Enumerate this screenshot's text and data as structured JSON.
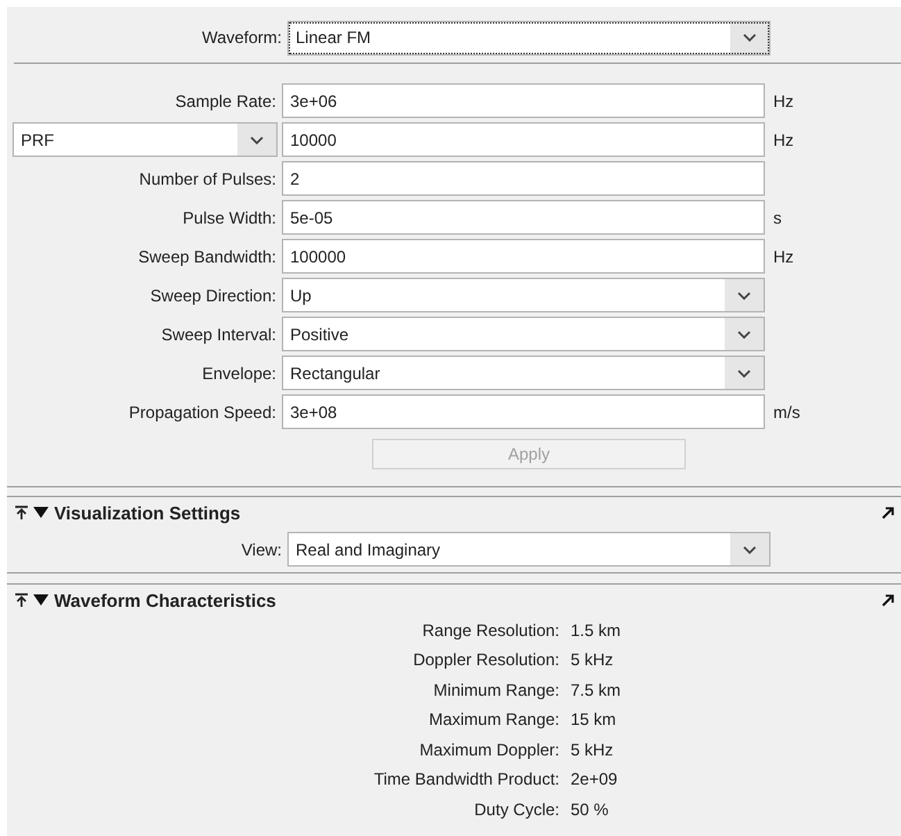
{
  "waveform": {
    "label": "Waveform:",
    "value": "Linear FM",
    "focused": true
  },
  "parameters": [
    {
      "label_selector": false,
      "label": "Sample Rate:",
      "kind": "field",
      "value": "3e+06",
      "unit": "Hz"
    },
    {
      "label_selector": true,
      "label": "PRF",
      "kind": "field",
      "value": "10000",
      "unit": "Hz"
    },
    {
      "label_selector": false,
      "label": "Number of Pulses:",
      "kind": "field",
      "value": "2"
    },
    {
      "label_selector": false,
      "label": "Pulse Width:",
      "kind": "field",
      "value": "5e-05",
      "unit": "s"
    },
    {
      "label_selector": false,
      "label": "Sweep Bandwidth:",
      "kind": "field",
      "value": "100000",
      "unit": "Hz"
    },
    {
      "label_selector": false,
      "label": "Sweep Direction:",
      "kind": "dropdown",
      "value": "Up"
    },
    {
      "label_selector": false,
      "label": "Sweep Interval:",
      "kind": "dropdown",
      "value": "Positive"
    },
    {
      "label_selector": false,
      "label": "Envelope:",
      "kind": "dropdown",
      "value": "Rectangular"
    },
    {
      "label_selector": false,
      "label": "Propagation Speed:",
      "kind": "field",
      "value": "3e+08",
      "unit": "m/s"
    }
  ],
  "apply_button": {
    "label": "Apply",
    "disabled": true
  },
  "visualization_settings": {
    "title": "Visualization Settings",
    "expanded": true,
    "view": {
      "label": "View:",
      "value": "Real and Imaginary"
    }
  },
  "waveform_characteristics": {
    "title": "Waveform Characteristics",
    "expanded": true,
    "items": [
      {
        "label": "Range Resolution:",
        "value": "1.5 km"
      },
      {
        "label": "Doppler Resolution:",
        "value": "5 kHz"
      },
      {
        "label": "Minimum Range:",
        "value": "7.5 km"
      },
      {
        "label": "Maximum Range:",
        "value": "15 km"
      },
      {
        "label": "Maximum Doppler:",
        "value": "5 kHz"
      },
      {
        "label": "Time Bandwidth Product:",
        "value": "2e+09"
      },
      {
        "label": "Duty Cycle:",
        "value": "50 %"
      }
    ]
  }
}
